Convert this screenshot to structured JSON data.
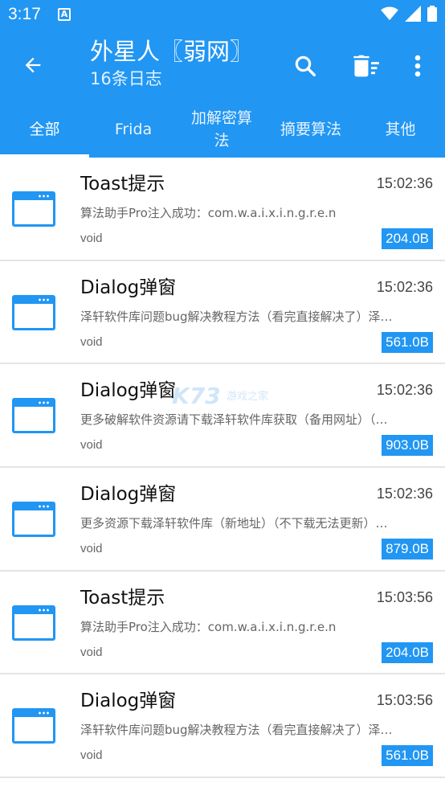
{
  "status": {
    "time": "3:17",
    "a_icon": "A"
  },
  "appbar": {
    "title": "外星人〖弱网〗",
    "subtitle": "16条日志",
    "icons": [
      "arrow-back-icon",
      "search-icon",
      "delete-sweep-icon",
      "more-vert-icon"
    ]
  },
  "tabs": [
    {
      "label": "全部",
      "active": true
    },
    {
      "label": "Frida",
      "active": false
    },
    {
      "label": "加解密算法",
      "active": false
    },
    {
      "label": "摘要算法",
      "active": false
    },
    {
      "label": "其他",
      "active": false
    }
  ],
  "rows": [
    {
      "title": "Toast提示",
      "time": "15:02:36",
      "desc": "算法助手Pro注入成功：com.w.a.i.x.i.n.g.r.e.n",
      "type": "void",
      "size": "204.0B"
    },
    {
      "title": "Dialog弹窗",
      "time": "15:02:36",
      "desc": "泽轩软件库问题bug解决教程方法（看完直接解决了）泽…",
      "type": "void",
      "size": "561.0B"
    },
    {
      "title": "Dialog弹窗",
      "time": "15:02:36",
      "desc": "更多破解软件资源请下载泽轩软件库获取（备用网址）（…",
      "type": "void",
      "size": "903.0B"
    },
    {
      "title": "Dialog弹窗",
      "time": "15:02:36",
      "desc": "更多资源下载泽轩软件库（新地址）（不下载无法更新）…",
      "type": "void",
      "size": "879.0B"
    },
    {
      "title": "Toast提示",
      "time": "15:03:56",
      "desc": "算法助手Pro注入成功：com.w.a.i.x.i.n.g.r.e.n",
      "type": "void",
      "size": "204.0B"
    },
    {
      "title": "Dialog弹窗",
      "time": "15:03:56",
      "desc": "泽轩软件库问题bug解决教程方法（看完直接解决了）泽…",
      "type": "void",
      "size": "561.0B"
    }
  ],
  "watermark": {
    "text": "K73",
    "sub": "游戏之家"
  },
  "colors": {
    "primary": "#2196f3",
    "white": "#ffffff"
  }
}
